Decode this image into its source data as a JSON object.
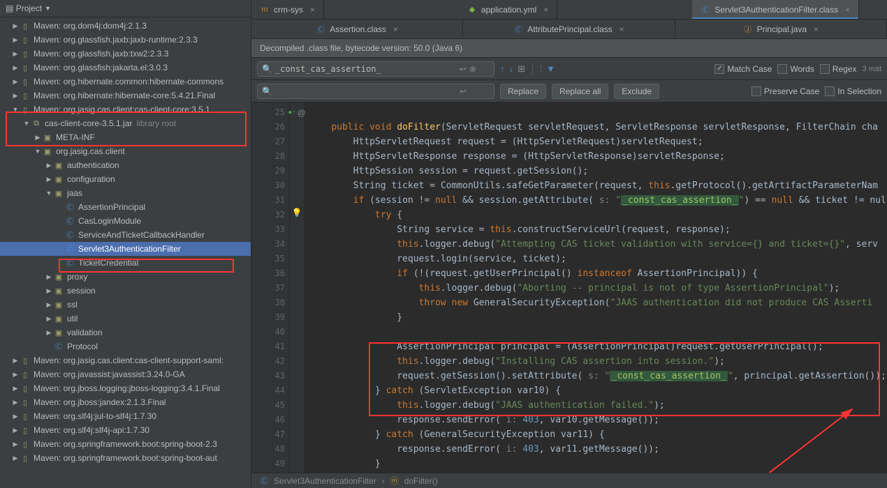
{
  "sidebar": {
    "title": "Project",
    "items": [
      {
        "indent": 1,
        "arrow": "▶",
        "icon": "lib",
        "label": "Maven: org.dom4j:dom4j:2.1.3"
      },
      {
        "indent": 1,
        "arrow": "▶",
        "icon": "lib",
        "label": "Maven: org.glassfish.jaxb:jaxb-runtime:2.3.3"
      },
      {
        "indent": 1,
        "arrow": "▶",
        "icon": "lib",
        "label": "Maven: org.glassfish.jaxb:txw2:2.3.3"
      },
      {
        "indent": 1,
        "arrow": "▶",
        "icon": "lib",
        "label": "Maven: org.glassfish:jakarta.el:3.0.3"
      },
      {
        "indent": 1,
        "arrow": "▶",
        "icon": "lib",
        "label": "Maven: org.hibernate.common:hibernate-commons"
      },
      {
        "indent": 1,
        "arrow": "▶",
        "icon": "lib",
        "label": "Maven: org.hibernate:hibernate-core:5.4.21.Final"
      },
      {
        "indent": 1,
        "arrow": "▼",
        "icon": "lib",
        "label": "Maven: org.jasig.cas.client:cas-client-core:3.5.1"
      },
      {
        "indent": 2,
        "arrow": "▼",
        "icon": "jar",
        "label": "cas-client-core-3.5.1.jar",
        "suffix": "library root"
      },
      {
        "indent": 3,
        "arrow": "▶",
        "icon": "folder",
        "label": "META-INF"
      },
      {
        "indent": 3,
        "arrow": "▼",
        "icon": "pkg",
        "label": "org.jasig.cas.client"
      },
      {
        "indent": 4,
        "arrow": "▶",
        "icon": "pkg",
        "label": "authentication"
      },
      {
        "indent": 4,
        "arrow": "▶",
        "icon": "pkg",
        "label": "configuration"
      },
      {
        "indent": 4,
        "arrow": "▼",
        "icon": "pkg",
        "label": "jaas"
      },
      {
        "indent": 5,
        "arrow": "",
        "icon": "class",
        "label": "AssertionPrincipal"
      },
      {
        "indent": 5,
        "arrow": "",
        "icon": "class",
        "label": "CasLoginModule"
      },
      {
        "indent": 5,
        "arrow": "",
        "icon": "class",
        "label": "ServiceAndTicketCallbackHandler"
      },
      {
        "indent": 5,
        "arrow": "",
        "icon": "class",
        "label": "Servlet3AuthenticationFilter",
        "selected": true
      },
      {
        "indent": 5,
        "arrow": "",
        "icon": "class",
        "label": "TicketCredential"
      },
      {
        "indent": 4,
        "arrow": "▶",
        "icon": "pkg",
        "label": "proxy"
      },
      {
        "indent": 4,
        "arrow": "▶",
        "icon": "pkg",
        "label": "session"
      },
      {
        "indent": 4,
        "arrow": "▶",
        "icon": "pkg",
        "label": "ssl"
      },
      {
        "indent": 4,
        "arrow": "▶",
        "icon": "pkg",
        "label": "util"
      },
      {
        "indent": 4,
        "arrow": "▶",
        "icon": "pkg",
        "label": "validation"
      },
      {
        "indent": 4,
        "arrow": "",
        "icon": "class",
        "label": "Protocol"
      },
      {
        "indent": 1,
        "arrow": "▶",
        "icon": "lib",
        "label": "Maven: org.jasig.cas.client:cas-client-support-saml:"
      },
      {
        "indent": 1,
        "arrow": "▶",
        "icon": "lib",
        "label": "Maven: org.javassist:javassist:3.24.0-GA"
      },
      {
        "indent": 1,
        "arrow": "▶",
        "icon": "lib",
        "label": "Maven: org.jboss.logging:jboss-logging:3.4.1.Final"
      },
      {
        "indent": 1,
        "arrow": "▶",
        "icon": "lib",
        "label": "Maven: org.jboss:jandex:2.1.3.Final"
      },
      {
        "indent": 1,
        "arrow": "▶",
        "icon": "lib",
        "label": "Maven: org.slf4j:jul-to-slf4j:1.7.30"
      },
      {
        "indent": 1,
        "arrow": "▶",
        "icon": "lib",
        "label": "Maven: org.slf4j:slf4j-api:1.7.30"
      },
      {
        "indent": 1,
        "arrow": "▶",
        "icon": "lib",
        "label": "Maven: org.springframework.boot:spring-boot-2.3"
      },
      {
        "indent": 1,
        "arrow": "▶",
        "icon": "lib",
        "label": "Maven: org.springframework.boot:spring-boot-aut"
      }
    ]
  },
  "tabs_top": [
    {
      "icon": "m",
      "label": "crm-sys",
      "close": true
    },
    {
      "icon": "yml",
      "label": "application.yml",
      "close": true
    },
    {
      "icon": "cls",
      "label": "Servlet3AuthenticationFilter.class",
      "close": true,
      "active": true
    }
  ],
  "tabs_sub": [
    {
      "icon": "cls",
      "label": "Assertion.class",
      "close": true
    },
    {
      "icon": "cls",
      "label": "AttributePrincipal.class",
      "close": true
    },
    {
      "icon": "java",
      "label": "Principal.java",
      "close": true
    }
  ],
  "banner": "Decompiled .class file, bytecode version: 50.0 (Java 6)",
  "search": {
    "query": "_const_cas_assertion_",
    "replace_placeholder": "",
    "btn_replace": "Replace",
    "btn_replace_all": "Replace all",
    "btn_exclude": "Exclude",
    "match_case": "Match Case",
    "words": "Words",
    "regex": "Regex",
    "preserve_case": "Preserve Case",
    "in_selection": "In Selection",
    "match_count": "3 mat"
  },
  "gutter_start": 25,
  "gutter_count": 25,
  "breadcrumb": {
    "class": "Servlet3AuthenticationFilter",
    "method": "doFilter()"
  },
  "code": {
    "l1": {
      "a": "public void ",
      "b": "doFilter",
      "c": "(ServletRequest servletRequest, ServletResponse servletResponse, FilterChain cha"
    },
    "l2": "HttpServletRequest request = (HttpServletRequest)servletRequest;",
    "l3": "HttpServletResponse response = (HttpServletResponse)servletResponse;",
    "l4": "HttpSession session = request.getSession();",
    "l5": {
      "a": "String ticket = CommonUtils.safeGetParameter(request, ",
      "b": "this",
      "c": ".getProtocol().getArtifactParameterNam"
    },
    "l6": {
      "a": "if ",
      "b": "(session != ",
      "c": "null",
      "d": " && session.getAttribute( ",
      "e": "s: ",
      "f": "\"",
      "g": "_const_cas_assertion_",
      "h": "\"",
      "i": ") == ",
      "j": "null",
      "k": " && ticket != nul"
    },
    "l7": {
      "a": "try ",
      "b": "{"
    },
    "l8": {
      "a": "String service = ",
      "b": "this",
      "c": ".constructServiceUrl(request, response);"
    },
    "l9": {
      "a": "this",
      "b": ".logger.debug(",
      "c": "\"Attempting CAS ticket validation with service={} and ticket={}\"",
      "d": ", serv"
    },
    "l10": "request.login(service, ticket);",
    "l11": {
      "a": "if ",
      "b": "(!(request.getUserPrincipal() ",
      "c": "instanceof",
      "d": " AssertionPrincipal)) {"
    },
    "l12": {
      "a": "this",
      "b": ".logger.debug(",
      "c": "\"Aborting -- principal is not of type AssertionPrincipal\"",
      "d": ");"
    },
    "l13": {
      "a": "throw new ",
      "b": "GeneralSecurityException(",
      "c": "\"JAAS authentication did not produce CAS Asserti"
    },
    "l14": "}",
    "l16": "AssertionPrincipal principal = (AssertionPrincipal)request.getUserPrincipal();",
    "l17": {
      "a": "this",
      "b": ".logger.debug(",
      "c": "\"Installing CAS assertion into session.\"",
      "d": ");"
    },
    "l18": {
      "a": "request.getSession().setAttribute( ",
      "e": "s: ",
      "b": "\"",
      "c": "_const_cas_assertion_",
      "d": "\"",
      "f": ", principal.getAssertion());"
    },
    "l19": {
      "a": "} ",
      "b": "catch ",
      "c": "(ServletException var10) {"
    },
    "l20": {
      "a": "this",
      "b": ".logger.debug(",
      "c": "\"JAAS authentication failed.\"",
      "d": ");"
    },
    "l21": {
      "a": "response.sendError( ",
      "e": "i: ",
      "b": "403",
      "c": ", var10.getMessage());"
    },
    "l22": {
      "a": "} ",
      "b": "catch ",
      "c": "(GeneralSecurityException var11) {"
    },
    "l23": {
      "a": "response.sendError( ",
      "e": "i: ",
      "b": "403",
      "c": ", var11.getMessage());"
    },
    "l24": "}"
  }
}
